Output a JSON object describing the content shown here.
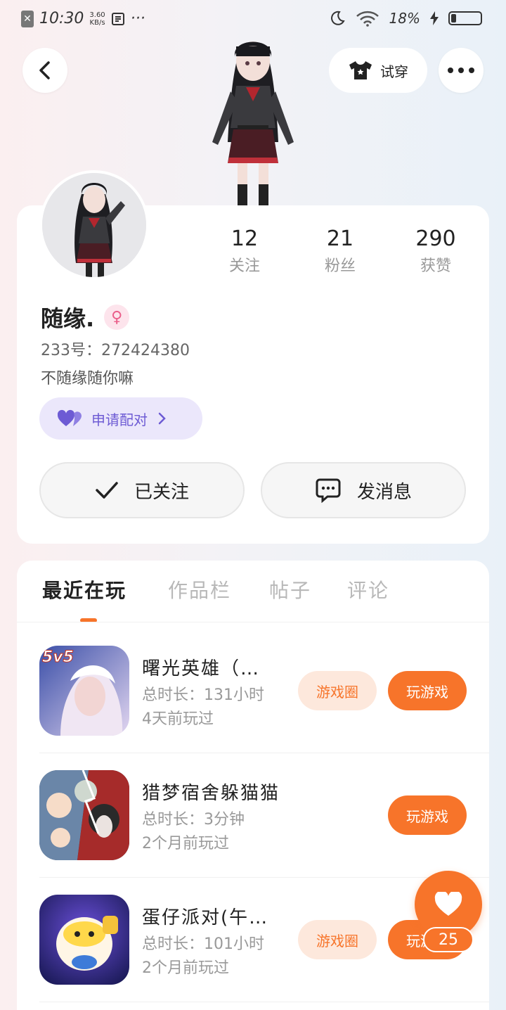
{
  "status_bar": {
    "time": "10:30",
    "net_speed_value": "3.60",
    "net_speed_unit": "KB/s",
    "dots": "···",
    "battery": "18%"
  },
  "header": {
    "tryon_label": "试穿"
  },
  "profile": {
    "nickname": "随缘.",
    "gender_symbol": "♀",
    "uid": "233号：272424380",
    "bio": "不随缘随你嘛",
    "pair_label": "申请配对",
    "stats": [
      {
        "value": "12",
        "label": "关注"
      },
      {
        "value": "21",
        "label": "粉丝"
      },
      {
        "value": "290",
        "label": "获赞"
      }
    ],
    "followed_label": "已关注",
    "message_label": "发消息"
  },
  "tabs": [
    "最近在玩",
    "作品栏",
    "帖子",
    "评论"
  ],
  "games": [
    {
      "name": "曙光英雄（…",
      "duration": "总时长：131小时",
      "last_played": "4天前玩过",
      "circle_label": "游戏圈",
      "play_label": "玩游戏",
      "icon_badge": "5v5"
    },
    {
      "name": "猎梦宿舍躲猫猫",
      "duration": "总时长：3分钟",
      "last_played": "2个月前玩过",
      "play_label": "玩游戏"
    },
    {
      "name": "蛋仔派对(午…",
      "duration": "总时长：101小时",
      "last_played": "2个月前玩过",
      "circle_label": "游戏圈",
      "play_label": "玩游戏"
    }
  ],
  "floating": {
    "like_count": "25"
  },
  "colors": {
    "accent": "#f7742a",
    "pair_purple": "#6d5bd4",
    "female_pink": "#ea5e8a"
  },
  "icons": {
    "back": "back-arrow-icon",
    "tryon": "shirt-icon",
    "more": "more-dots-icon",
    "check": "check-icon",
    "message": "chat-bubble-icon",
    "pair": "heart-pair-icon",
    "like": "heart-icon"
  }
}
